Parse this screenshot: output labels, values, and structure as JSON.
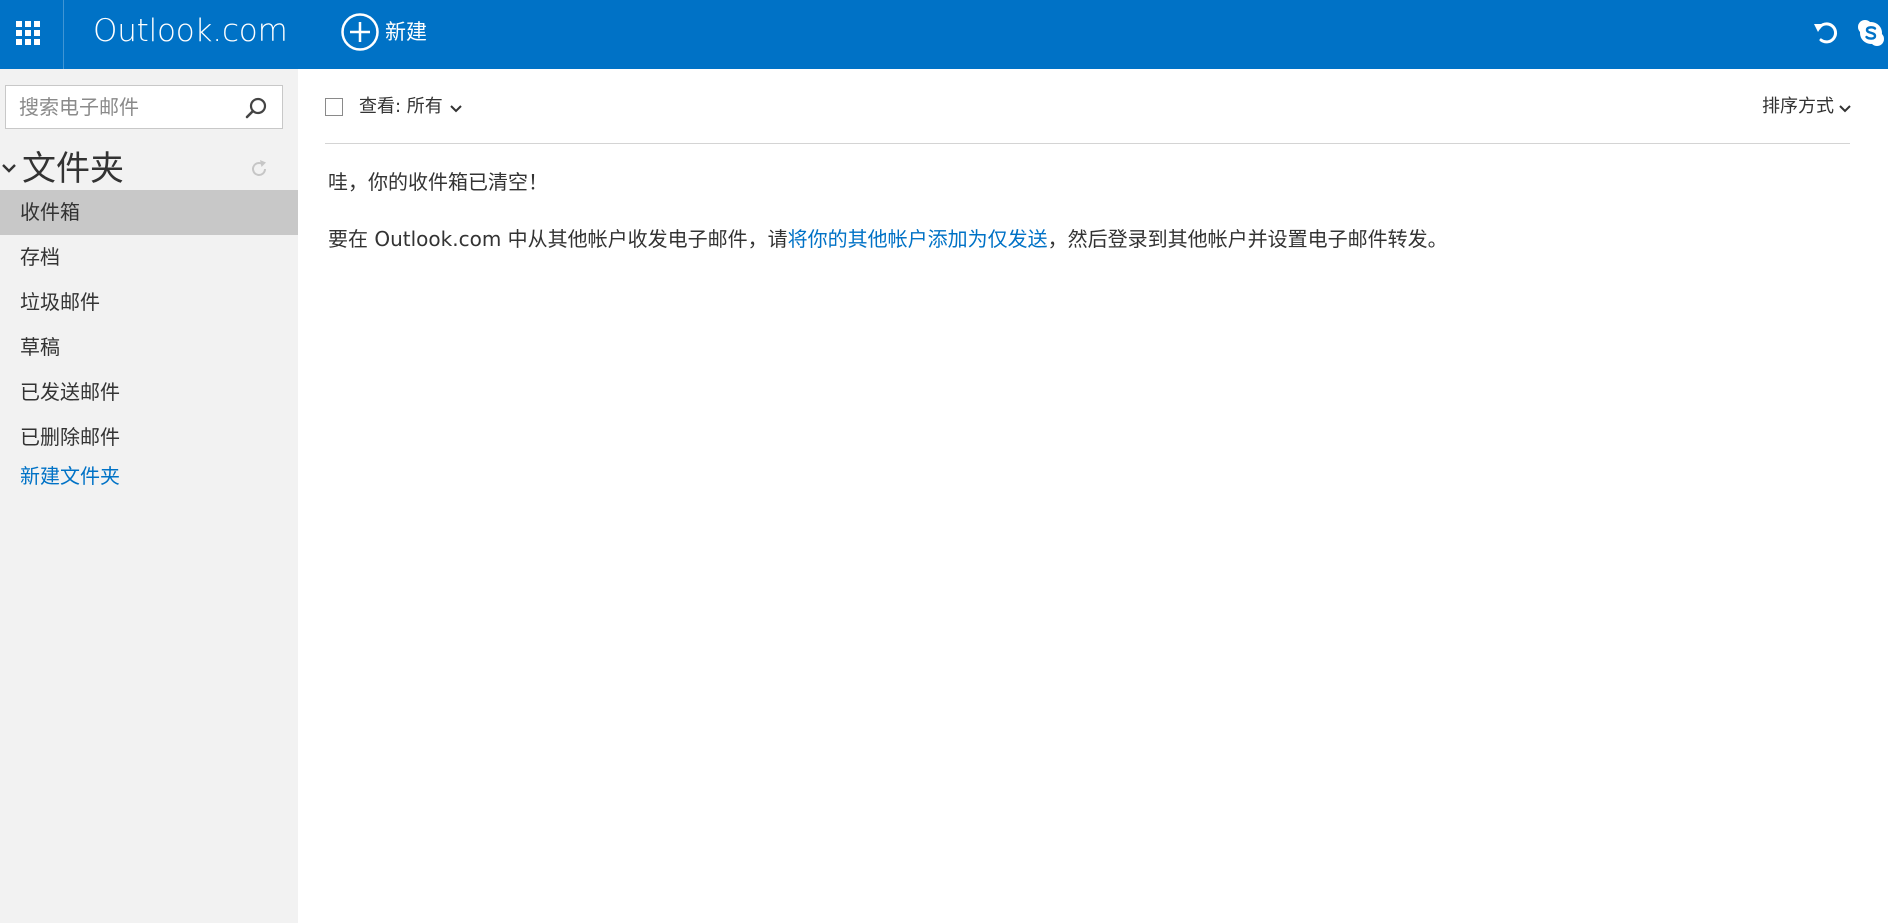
{
  "topbar": {
    "brand": "Outlook.com",
    "new_label": "新建",
    "icons": {
      "app_launcher": "waffle-grid-icon",
      "new": "plus-circle-icon",
      "undo": "undo-icon",
      "skype": "skype-icon"
    },
    "colors": {
      "background": "#0072c6",
      "text": "#ffffff"
    }
  },
  "sidebar": {
    "search_placeholder": "搜索电子邮件",
    "folders_title": "文件夹",
    "folders": [
      {
        "label": "收件箱",
        "selected": true
      },
      {
        "label": "存档",
        "selected": false
      },
      {
        "label": "垃圾邮件",
        "selected": false
      },
      {
        "label": "草稿",
        "selected": false
      },
      {
        "label": "已发送邮件",
        "selected": false
      },
      {
        "label": "已删除邮件",
        "selected": false
      }
    ],
    "new_folder_label": "新建文件夹",
    "colors": {
      "background": "#f2f2f2",
      "selected": "#c8c8c8",
      "link": "#0072c6"
    }
  },
  "main": {
    "view_label": "查看: 所有",
    "sort_label": "排序方式",
    "empty_message": "哇，你的收件箱已清空！",
    "info": {
      "prefix": "要在 Outlook.com 中从其他帐户收发电子邮件，请",
      "link": "将你的其他帐户添加为仅发送",
      "suffix": "，然后登录到其他帐户并设置电子邮件转发。"
    }
  }
}
